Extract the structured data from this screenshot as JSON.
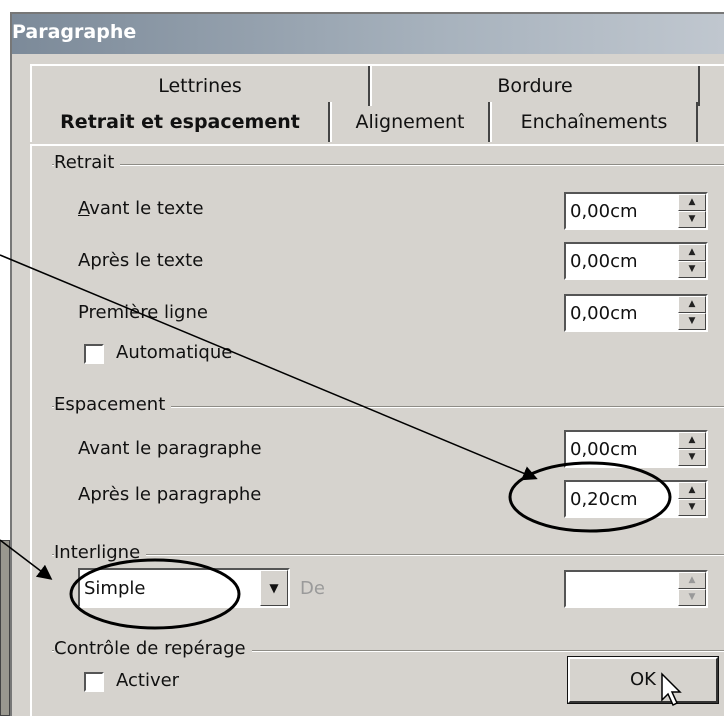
{
  "dialog": {
    "title": "Paragraphe"
  },
  "tabs_top": [
    "Lettrines",
    "Bordure"
  ],
  "tabs_front": [
    "Retrait et espacement",
    "Alignement",
    "Enchaînements"
  ],
  "retrait": {
    "label": "Retrait",
    "avant_label": "Avant le texte",
    "avant_value": "0,00cm",
    "apres_label": "Après le texte",
    "apres_value": "0,00cm",
    "premiere_label": "Première ligne",
    "premiere_value": "0,00cm",
    "auto_label": "Automatique"
  },
  "espacement": {
    "label": "Espacement",
    "avant_label": "Avant le paragraphe",
    "avant_value": "0,00cm",
    "apres_label": "Après le paragraphe",
    "apres_value": "0,20cm"
  },
  "interligne": {
    "label": "Interligne",
    "selected": "Simple",
    "de_label": "De",
    "de_value": ""
  },
  "controle": {
    "label": "Contrôle de repérage",
    "activer_label": "Activer"
  },
  "buttons": {
    "ok": "OK"
  }
}
